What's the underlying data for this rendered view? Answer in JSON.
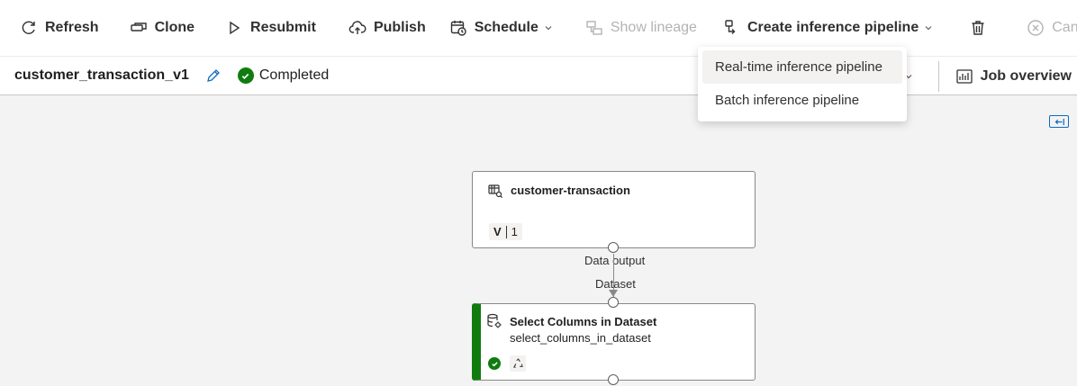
{
  "toolbar": {
    "refresh": "Refresh",
    "clone": "Clone",
    "resubmit": "Resubmit",
    "publish": "Publish",
    "schedule": "Schedule",
    "show_lineage": "Show lineage",
    "create_inference": "Create inference pipeline",
    "cancel": "Cancel"
  },
  "subheader": {
    "job_name": "customer_transaction_v1",
    "status": "Completed",
    "job_overview": "Job overview"
  },
  "dropdown": {
    "items": [
      "Real-time inference pipeline",
      "Batch inference pipeline"
    ]
  },
  "canvas": {
    "node1": {
      "title": "customer-transaction",
      "version_letter": "V",
      "version_number": "1",
      "output_port": "Data output"
    },
    "node2": {
      "input_port": "Dataset",
      "title": "Select Columns in Dataset",
      "subtitle": "select_columns_in_dataset",
      "status_color": "#107c10"
    }
  },
  "colors": {
    "accent": "#0f6cbd",
    "success": "#107c10"
  }
}
